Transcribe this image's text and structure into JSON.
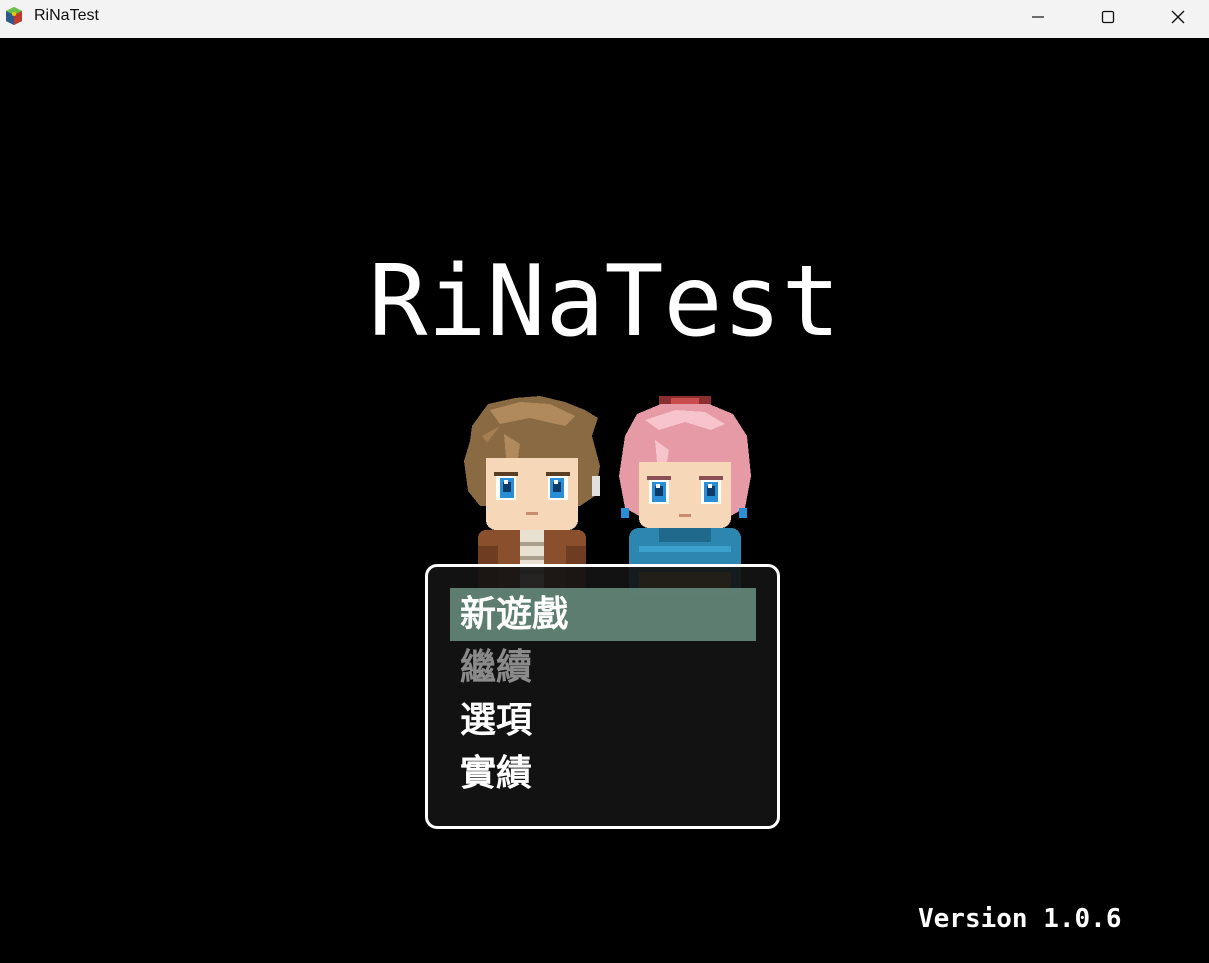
{
  "window": {
    "title": "RiNaTest",
    "icons": {
      "app": "rpg-maker-app-icon",
      "minimize": "minimize-icon",
      "maximize": "maximize-icon",
      "close": "close-icon"
    }
  },
  "game": {
    "title": "RiNaTest",
    "characters": [
      "brown-haired-boy-sprite",
      "pink-haired-girl-sprite"
    ],
    "menu": {
      "items": [
        {
          "label": "新遊戲",
          "state": "selected"
        },
        {
          "label": "繼續",
          "state": "disabled"
        },
        {
          "label": "選項",
          "state": "normal"
        },
        {
          "label": "實績",
          "state": "normal"
        }
      ]
    },
    "version": "Version 1.0.6"
  },
  "colors": {
    "background": "#000000",
    "titlebar": "#f3f3f3",
    "menu_highlight": "#64877a",
    "menu_disabled": "#8a8a8a",
    "menu_border": "#ffffff"
  }
}
